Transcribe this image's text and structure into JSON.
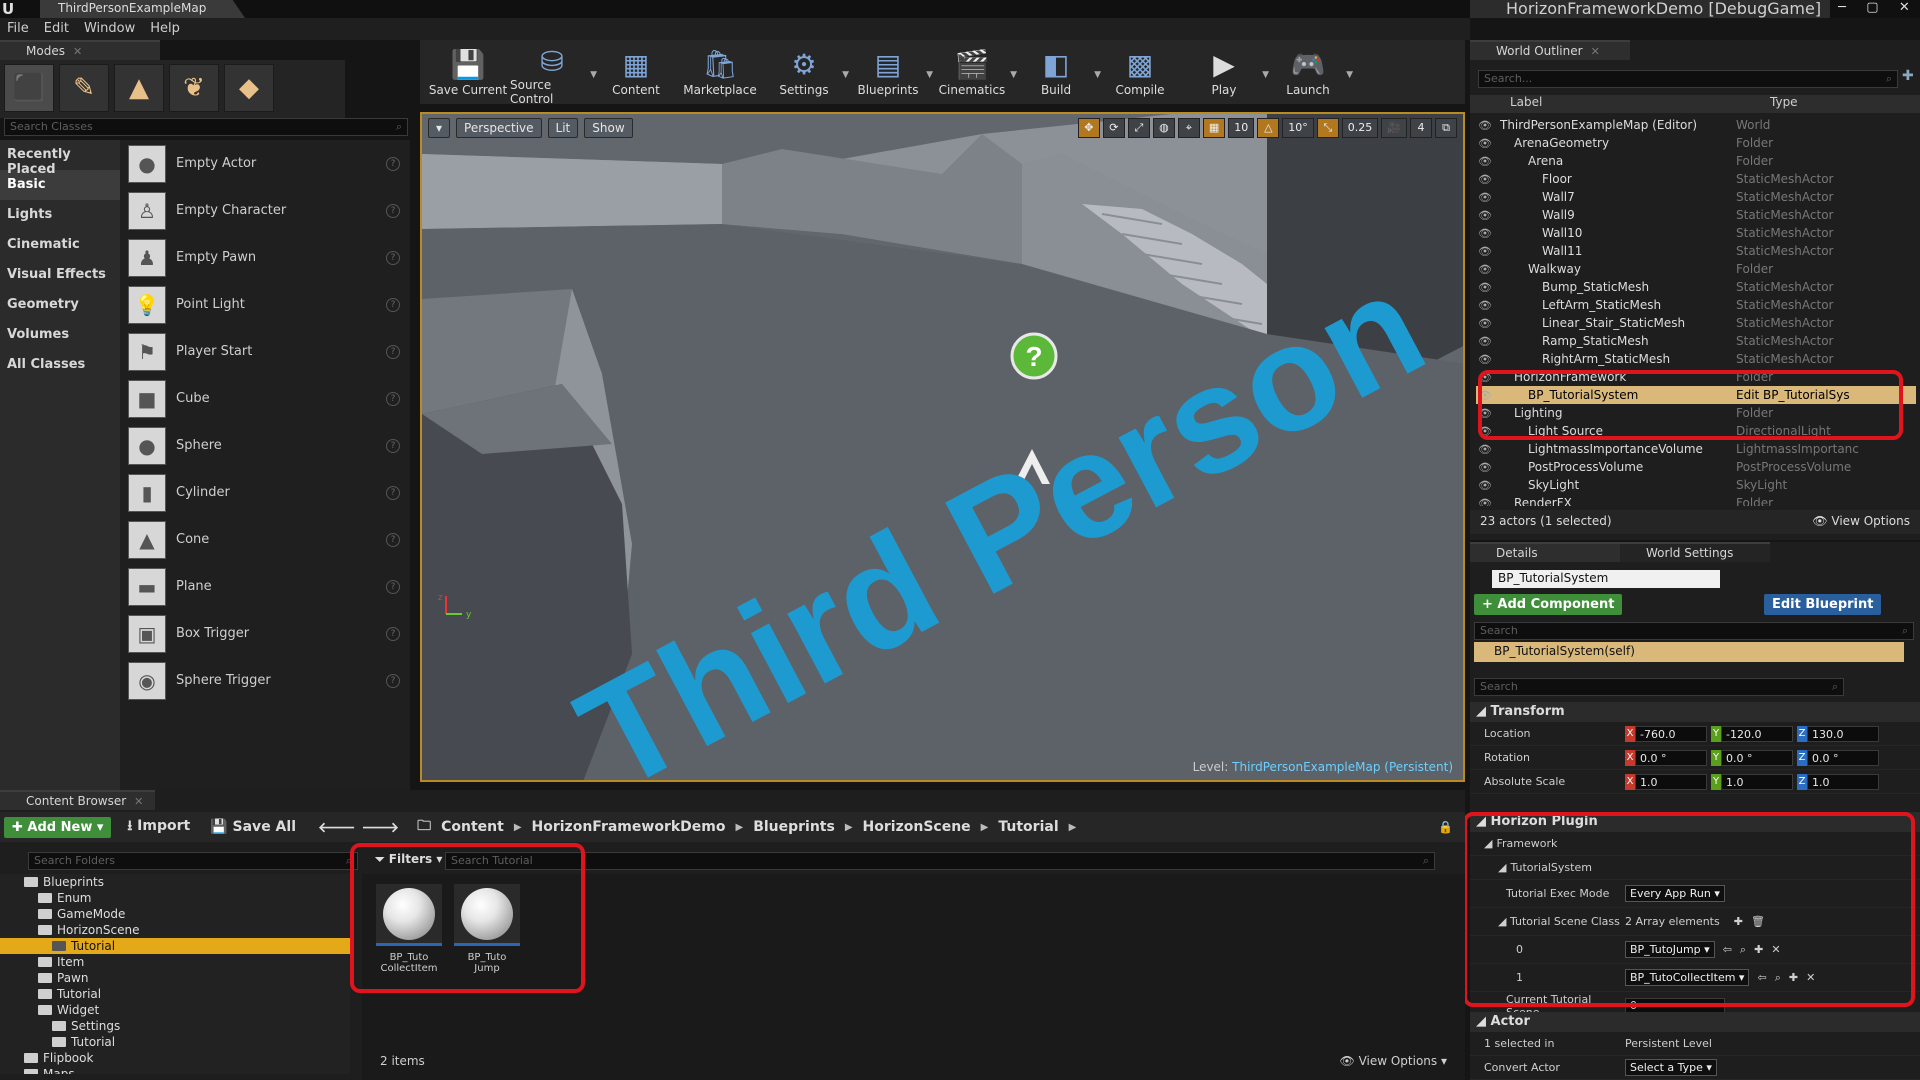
{
  "window": {
    "logo": "U",
    "tab_title": "ThirdPersonExampleMap",
    "project_title": "HorizonFrameworkDemo [DebugGame]",
    "win_controls": [
      "─",
      "▢",
      "✕"
    ]
  },
  "menu": [
    "File",
    "Edit",
    "Window",
    "Help"
  ],
  "modes": {
    "tab": "Modes",
    "search_placeholder": "Search Classes",
    "categories": [
      "Recently Placed",
      "Basic",
      "Lights",
      "Cinematic",
      "Visual Effects",
      "Geometry",
      "Volumes",
      "All Classes"
    ],
    "active_category": "Basic",
    "items": [
      "Empty Actor",
      "Empty Character",
      "Empty Pawn",
      "Point Light",
      "Player Start",
      "Cube",
      "Sphere",
      "Cylinder",
      "Cone",
      "Plane",
      "Box Trigger",
      "Sphere Trigger"
    ]
  },
  "toolbar": {
    "buttons": [
      "Save Current",
      "Source Control",
      "Content",
      "Marketplace",
      "Settings",
      "Blueprints",
      "Cinematics",
      "Build",
      "Compile",
      "Play",
      "Launch"
    ]
  },
  "viewport": {
    "perspective": "Perspective",
    "lit": "Lit",
    "show": "Show",
    "grid_snap": "10",
    "rot_snap": "10°",
    "scale_snap": "0.25",
    "cam_speed": "4",
    "level_prefix": "Level:",
    "level_name": "ThirdPersonExampleMap (Persistent)",
    "floor_text": "Third Person",
    "help_sprite": "?",
    "axis_labels": {
      "z": "z",
      "y": "y"
    }
  },
  "outliner": {
    "tab": "World Outliner",
    "search_placeholder": "Search...",
    "col_label": "Label",
    "col_type": "Type",
    "rows": [
      {
        "label": "ThirdPersonExampleMap (Editor)",
        "type": "World",
        "indent": 0
      },
      {
        "label": "ArenaGeometry",
        "type": "Folder",
        "indent": 1
      },
      {
        "label": "Arena",
        "type": "Folder",
        "indent": 2
      },
      {
        "label": "Floor",
        "type": "StaticMeshActor",
        "indent": 3
      },
      {
        "label": "Wall7",
        "type": "StaticMeshActor",
        "indent": 3
      },
      {
        "label": "Wall9",
        "type": "StaticMeshActor",
        "indent": 3
      },
      {
        "label": "Wall10",
        "type": "StaticMeshActor",
        "indent": 3
      },
      {
        "label": "Wall11",
        "type": "StaticMeshActor",
        "indent": 3
      },
      {
        "label": "Walkway",
        "type": "Folder",
        "indent": 2
      },
      {
        "label": "Bump_StaticMesh",
        "type": "StaticMeshActor",
        "indent": 3
      },
      {
        "label": "LeftArm_StaticMesh",
        "type": "StaticMeshActor",
        "indent": 3
      },
      {
        "label": "Linear_Stair_StaticMesh",
        "type": "StaticMeshActor",
        "indent": 3
      },
      {
        "label": "Ramp_StaticMesh",
        "type": "StaticMeshActor",
        "indent": 3
      },
      {
        "label": "RightArm_StaticMesh",
        "type": "StaticMeshActor",
        "indent": 3
      },
      {
        "label": "HorizonFramework",
        "type": "Folder",
        "indent": 1
      },
      {
        "label": "BP_TutorialSystem",
        "type": "Edit BP_TutorialSys",
        "indent": 2,
        "selected": true
      },
      {
        "label": "Lighting",
        "type": "Folder",
        "indent": 1
      },
      {
        "label": "Light Source",
        "type": "DirectionalLight",
        "indent": 2
      },
      {
        "label": "LightmassImportanceVolume",
        "type": "LightmassImportanc",
        "indent": 2
      },
      {
        "label": "PostProcessVolume",
        "type": "PostProcessVolume",
        "indent": 2
      },
      {
        "label": "SkyLight",
        "type": "SkyLight",
        "indent": 2
      },
      {
        "label": "RenderFX",
        "type": "Folder",
        "indent": 1
      }
    ],
    "actor_count": "23 actors (1 selected)",
    "view_options": "View Options"
  },
  "details": {
    "tab": "Details",
    "tab2": "World Settings",
    "object_name": "BP_TutorialSystem",
    "add_component": "+ Add Component",
    "edit_blueprint": "Edit Blueprint",
    "search_placeholder": "Search",
    "self_component": "BP_TutorialSystem(self)",
    "transform_header": "Transform",
    "location_label": "Location",
    "rotation_label": "Rotation",
    "scale_label": "Absolute Scale",
    "location": [
      "-760.0",
      "-120.0",
      "130.0"
    ],
    "rotation": [
      "0.0 °",
      "0.0 °",
      "0.0 °"
    ],
    "scale": [
      "1.0",
      "1.0",
      "1.0"
    ],
    "plugin_header": "Horizon Plugin",
    "framework": "Framework",
    "tutorial_system": "TutorialSystem",
    "exec_mode_label": "Tutorial Exec Mode",
    "exec_mode_value": "Every App Run",
    "scene_class_label": "Tutorial Scene Class",
    "array_elements": "2 Array elements",
    "elem0_index": "0",
    "elem0_value": "BP_TutoJump",
    "elem1_index": "1",
    "elem1_value": "BP_TutoCollectItem",
    "current_scene_label": "Current Tutorial Scene",
    "current_scene_value": "0",
    "actor_header": "Actor",
    "selected_in_label": "1 selected in",
    "selected_in_value": "Persistent Level",
    "convert_label": "Convert Actor",
    "convert_value": "Select a Type"
  },
  "content_browser": {
    "tab": "Content Browser",
    "add_new": "Add New",
    "import": "Import",
    "save_all": "Save All",
    "breadcrumb": [
      "Content",
      "HorizonFrameworkDemo",
      "Blueprints",
      "HorizonScene",
      "Tutorial"
    ],
    "folder_search_placeholder": "Search Folders",
    "filters": "Filters",
    "asset_search_placeholder": "Search Tutorial",
    "folders": [
      {
        "label": "Blueprints",
        "indent": 1
      },
      {
        "label": "Enum",
        "indent": 2
      },
      {
        "label": "GameMode",
        "indent": 2
      },
      {
        "label": "HorizonScene",
        "indent": 2
      },
      {
        "label": "Tutorial",
        "indent": 3,
        "selected": true
      },
      {
        "label": "Item",
        "indent": 2
      },
      {
        "label": "Pawn",
        "indent": 2
      },
      {
        "label": "Tutorial",
        "indent": 2
      },
      {
        "label": "Widget",
        "indent": 2
      },
      {
        "label": "Settings",
        "indent": 3
      },
      {
        "label": "Tutorial",
        "indent": 3
      },
      {
        "label": "Flipbook",
        "indent": 1
      },
      {
        "label": "Maps",
        "indent": 1
      }
    ],
    "assets": [
      {
        "line1": "BP_Tuto",
        "line2": "CollectItem"
      },
      {
        "line1": "BP_Tuto",
        "line2": "Jump"
      }
    ],
    "item_count": "2 items",
    "view_options": "View Options"
  },
  "colors": {
    "highlight_red": "#e0141c",
    "selection": "#d9b87a",
    "folder_selected": "#e3a918",
    "floor_text": "#1d9bd1"
  }
}
